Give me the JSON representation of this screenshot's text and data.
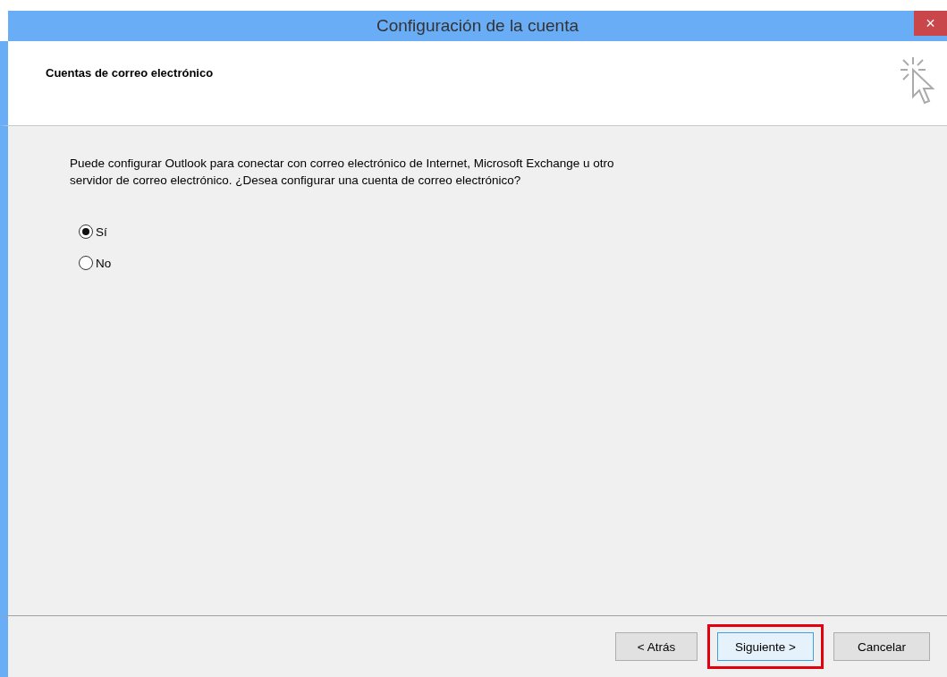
{
  "window": {
    "title": "Configuración de la cuenta",
    "close": "×"
  },
  "header": {
    "title": "Cuentas de correo electrónico"
  },
  "description": "Puede configurar Outlook para conectar con correo electrónico de Internet, Microsoft Exchange u otro servidor de correo electrónico. ¿Desea configurar una cuenta de correo electrónico?",
  "options": [
    {
      "label": "Sí",
      "selected": true
    },
    {
      "label": "No",
      "selected": false
    }
  ],
  "buttons": [
    {
      "label": "< Atrás",
      "focused": false,
      "highlighted": false
    },
    {
      "label": "Siguiente >",
      "focused": true,
      "highlighted": true
    },
    {
      "label": "Cancelar",
      "focused": false,
      "highlighted": false
    }
  ]
}
